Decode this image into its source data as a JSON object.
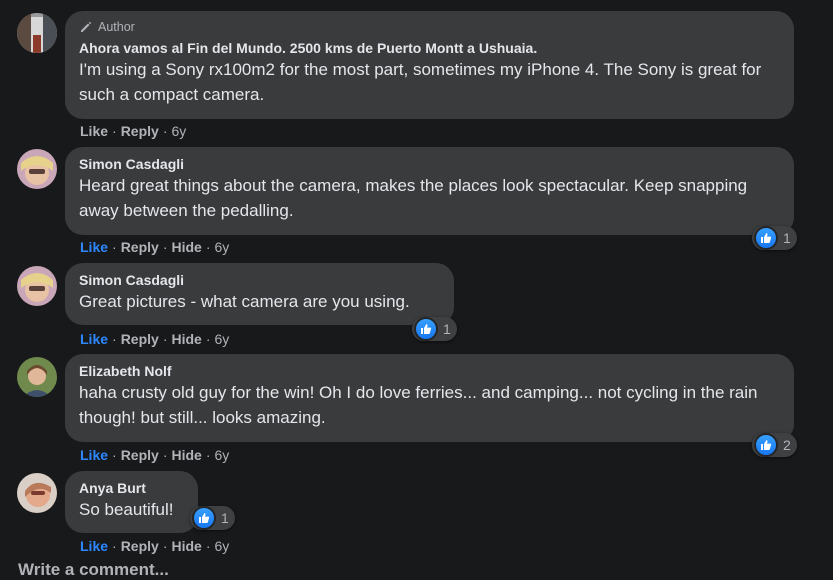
{
  "colors": {
    "background": "#18191a",
    "bubble": "#3a3b3c",
    "text": "#e4e6eb",
    "secondary": "#b0b3b8",
    "liked": "#2d88ff",
    "reaction_blue": "#1877f2"
  },
  "comments": [
    {
      "badge": "Author",
      "badge_icon": "pencil-icon",
      "name": "Ahora vamos al Fin del Mundo. 2500 kms de Puerto Montt a Ushuaia.",
      "text": "I'm using a Sony rx100m2 for the most part, sometimes my iPhone 4. The Sony is great for such a compact camera.",
      "actions": {
        "like": "Like",
        "reply": "Reply",
        "age": "6y"
      }
    },
    {
      "name": "Simon Casdagli",
      "text": "Heard great things about the camera, makes the places look spectacular. Keep snapping away between the pedalling.",
      "actions": {
        "like": "Like",
        "reply": "Reply",
        "hide": "Hide",
        "age": "6y"
      },
      "reaction": {
        "icon": "thumbs-up-icon",
        "count": "1"
      }
    },
    {
      "name": "Simon Casdagli",
      "text": "Great pictures - what camera are you using.",
      "actions": {
        "like": "Like",
        "reply": "Reply",
        "hide": "Hide",
        "age": "6y"
      },
      "reaction": {
        "icon": "thumbs-up-icon",
        "count": "1"
      }
    },
    {
      "name": "Elizabeth Nolf",
      "text": "haha crusty old guy for the win! Oh I do love ferries... and camping... not cycling in the rain though! but still... looks amazing.",
      "actions": {
        "like": "Like",
        "reply": "Reply",
        "hide": "Hide",
        "age": "6y"
      },
      "reaction": {
        "icon": "thumbs-up-icon",
        "count": "2"
      }
    },
    {
      "name": "Anya Burt",
      "text": "So beautiful!",
      "actions": {
        "like": "Like",
        "reply": "Reply",
        "hide": "Hide",
        "age": "6y"
      },
      "reaction": {
        "icon": "thumbs-up-icon",
        "count": "1"
      }
    }
  ],
  "write_comment": "Write a comment..."
}
